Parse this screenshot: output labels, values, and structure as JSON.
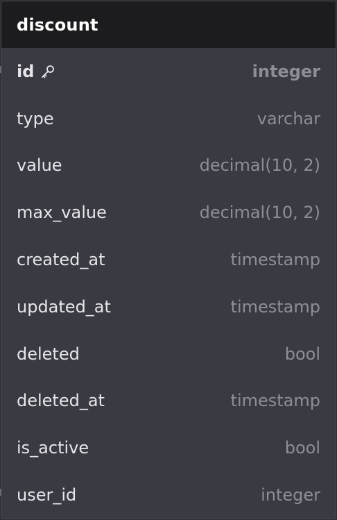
{
  "table": {
    "name": "discount",
    "columns": [
      {
        "name": "id",
        "type": "integer",
        "primary_key": true,
        "icon": "key-icon"
      },
      {
        "name": "type",
        "type": "varchar"
      },
      {
        "name": "value",
        "type": "decimal(10, 2)"
      },
      {
        "name": "max_value",
        "type": "decimal(10, 2)"
      },
      {
        "name": "created_at",
        "type": "timestamp"
      },
      {
        "name": "updated_at",
        "type": "timestamp"
      },
      {
        "name": "deleted",
        "type": "bool"
      },
      {
        "name": "deleted_at",
        "type": "timestamp"
      },
      {
        "name": "is_active",
        "type": "bool"
      },
      {
        "name": "user_id",
        "type": "integer"
      }
    ]
  },
  "colors": {
    "header_bg": "#1c1c1e",
    "body_bg": "#393a42",
    "name_text": "#e6e6ea",
    "type_text": "#8d8e96"
  }
}
